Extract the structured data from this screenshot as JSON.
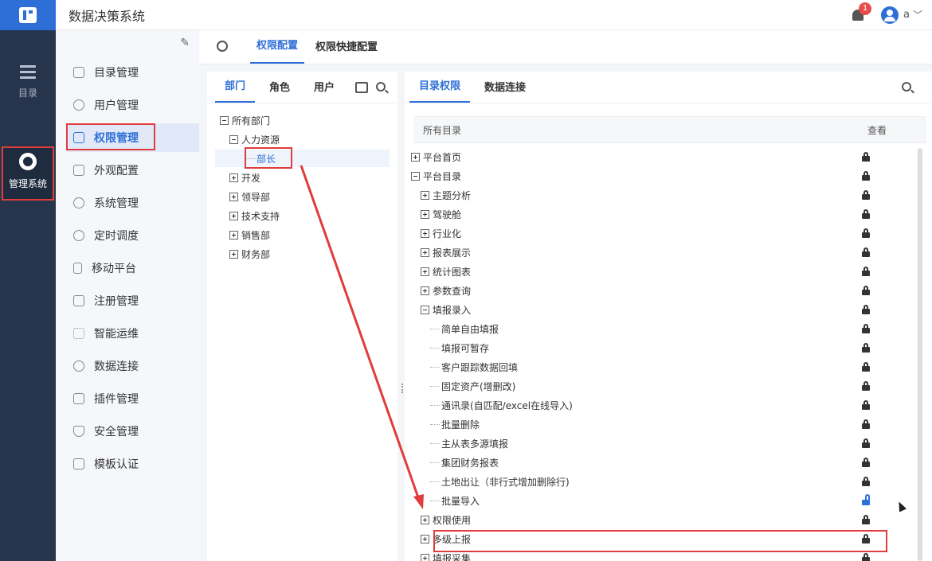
{
  "app": {
    "title": "数据决策系统"
  },
  "header": {
    "notification_count": "1",
    "user_name": "a"
  },
  "rail": {
    "catalog_label": "目录",
    "admin_label": "管理系统"
  },
  "nav": {
    "items": [
      {
        "label": "目录管理"
      },
      {
        "label": "用户管理"
      },
      {
        "label": "权限管理"
      },
      {
        "label": "外观配置"
      },
      {
        "label": "系统管理"
      },
      {
        "label": "定时调度"
      },
      {
        "label": "移动平台"
      },
      {
        "label": "注册管理"
      },
      {
        "label": "智能运维"
      },
      {
        "label": "数据连接"
      },
      {
        "label": "插件管理"
      },
      {
        "label": "安全管理"
      },
      {
        "label": "模板认证"
      }
    ]
  },
  "main_tabs": [
    {
      "label": "权限配置"
    },
    {
      "label": "权限快捷配置"
    }
  ],
  "left_panel": {
    "tabs": [
      {
        "label": "部门"
      },
      {
        "label": "角色"
      },
      {
        "label": "用户"
      }
    ],
    "tree": [
      {
        "label": "所有部门"
      },
      {
        "label": "人力资源"
      },
      {
        "label": "部长"
      },
      {
        "label": "开发"
      },
      {
        "label": "领导部"
      },
      {
        "label": "技术支持"
      },
      {
        "label": "销售部"
      },
      {
        "label": "财务部"
      }
    ]
  },
  "right_panel": {
    "tabs": [
      {
        "label": "目录权限"
      },
      {
        "label": "数据连接"
      }
    ],
    "header": {
      "col_all": "所有目录",
      "col_view": "查看"
    },
    "rows": [
      {
        "label": "平台首页"
      },
      {
        "label": "平台目录"
      },
      {
        "label": "主题分析"
      },
      {
        "label": "驾驶舱"
      },
      {
        "label": "行业化"
      },
      {
        "label": "报表展示"
      },
      {
        "label": "统计图表"
      },
      {
        "label": "参数查询"
      },
      {
        "label": "填报录入"
      },
      {
        "label": "简单自由填报"
      },
      {
        "label": "填报可暂存"
      },
      {
        "label": "客户跟踪数据回填"
      },
      {
        "label": "固定资产(增删改)"
      },
      {
        "label": "通讯录(自匹配/excel在线导入)"
      },
      {
        "label": "批量删除"
      },
      {
        "label": "主从表多源填报"
      },
      {
        "label": "集团财务报表"
      },
      {
        "label": "土地出让（非行式增加删除行)"
      },
      {
        "label": "批量导入"
      },
      {
        "label": "权限使用"
      },
      {
        "label": "多级上报"
      },
      {
        "label": "填报采集"
      }
    ]
  },
  "colors": {
    "accent": "#2e6fd7",
    "highlight_border": "#e03c3c",
    "rail_bg": "#27354c"
  }
}
